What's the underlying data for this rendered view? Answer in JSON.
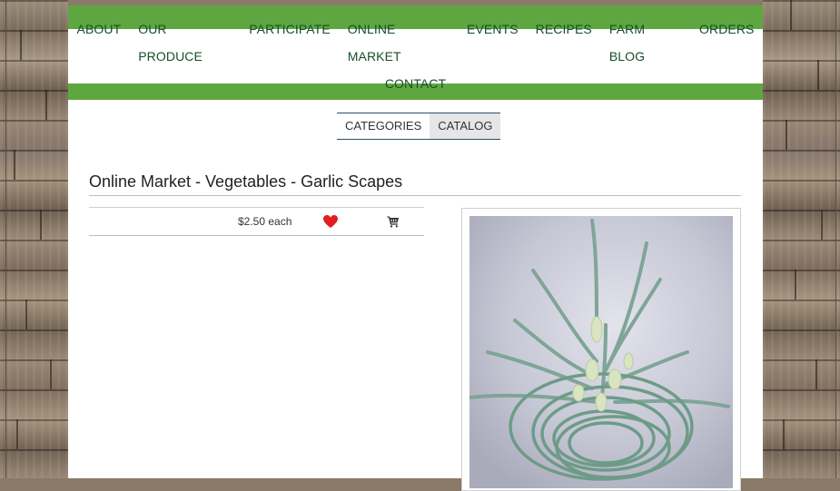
{
  "nav": {
    "row1": [
      "ABOUT",
      "OUR PRODUCE",
      "PARTICIPATE",
      "ONLINE MARKET",
      "EVENTS",
      "RECIPES",
      "FARM BLOG",
      "ORDERS"
    ],
    "row2": [
      "CONTACT"
    ]
  },
  "subtabs": {
    "categories": "CATEGORIES",
    "catalog": "CATALOG"
  },
  "product": {
    "title": "Online Market - Vegetables - Garlic Scapes",
    "price": "$2.50 each"
  },
  "icons": {
    "favorite": "heart-icon",
    "cart": "cart-icon",
    "photo": "garlic-scapes-photo"
  },
  "colors": {
    "nav_green": "#5ea740",
    "nav_text": "#184e2d",
    "heart": "#e02020"
  }
}
